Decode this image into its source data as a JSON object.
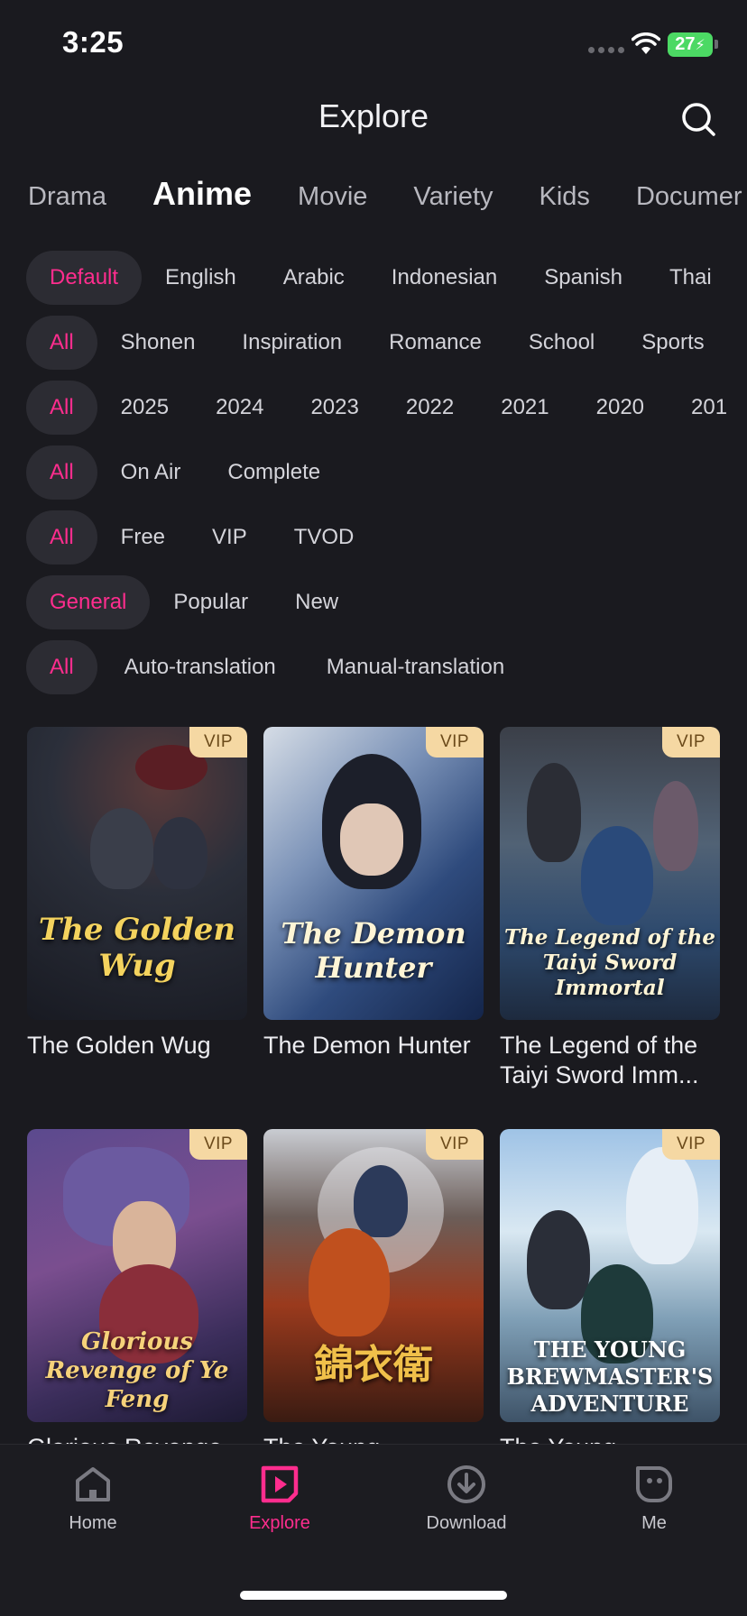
{
  "status_bar": {
    "time": "3:25",
    "battery": "27"
  },
  "header": {
    "title": "Explore",
    "search_icon": "search-icon"
  },
  "category_tabs": [
    "Drama",
    "Anime",
    "Movie",
    "Variety",
    "Kids",
    "Documentary"
  ],
  "category_tabs_display": [
    "Drama",
    "Anime",
    "Movie",
    "Variety",
    "Kids",
    "Documer"
  ],
  "active_category": "Anime",
  "filters": {
    "language": [
      "Default",
      "English",
      "Arabic",
      "Indonesian",
      "Spanish",
      "Thai"
    ],
    "genre": [
      "All",
      "Shonen",
      "Inspiration",
      "Romance",
      "School",
      "Sports"
    ],
    "year": [
      "All",
      "2025",
      "2024",
      "2023",
      "2022",
      "2021",
      "2020",
      "201"
    ],
    "status": [
      "All",
      "On Air",
      "Complete"
    ],
    "payment": [
      "All",
      "Free",
      "VIP",
      "TVOD"
    ],
    "sort": [
      "General",
      "Popular",
      "New"
    ],
    "translation": [
      "All",
      "Auto-translation",
      "Manual-translation"
    ]
  },
  "badge_label": "VIP",
  "cards": [
    {
      "title": "The Golden Wug",
      "poster_text": "The Golden Wug",
      "badge": "VIP"
    },
    {
      "title": "The Demon Hunter",
      "poster_text": "The Demon Hunter",
      "badge": "VIP"
    },
    {
      "title": "The Legend of the Taiyi Sword Imm...",
      "poster_text": "The Legend of the Taiyi Sword Immortal",
      "badge": "VIP"
    },
    {
      "title": "Glorious Revenge",
      "poster_text": "Glorious Revenge of Ye Feng",
      "badge": "VIP"
    },
    {
      "title": "The Young",
      "poster_text": "錦衣衛",
      "badge": "VIP"
    },
    {
      "title": "The Young",
      "poster_text": "THE YOUNG BREWMASTER'S ADVENTURE",
      "badge": "VIP"
    }
  ],
  "bottom_nav": [
    {
      "label": "Home",
      "icon": "home-icon"
    },
    {
      "label": "Explore",
      "icon": "explore-icon"
    },
    {
      "label": "Download",
      "icon": "download-icon"
    },
    {
      "label": "Me",
      "icon": "profile-icon"
    }
  ],
  "colors": {
    "accent": "#ff2d8e",
    "background": "#1a1a1f",
    "chip_active": "#2c2c33",
    "vip_badge": "#f5d8a3"
  }
}
